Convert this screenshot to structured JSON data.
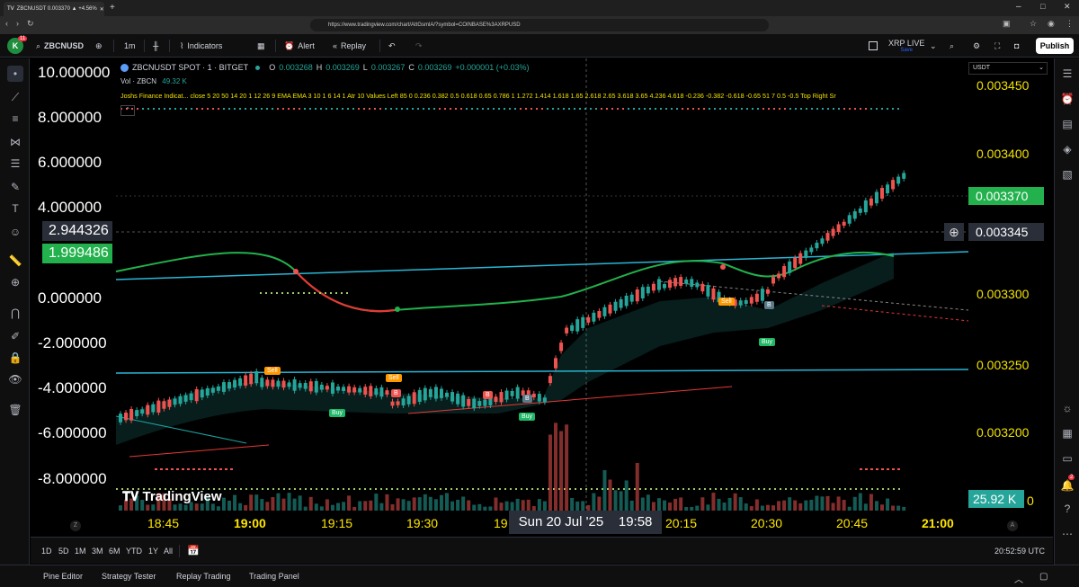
{
  "browser": {
    "tab_title": "ZBCNUSDT 0.003370 ▲ +4.56%",
    "url": "https://www.tradingview.com/chart/AttGsmlA/?symbol=COINBASE%3AXRPUSD"
  },
  "toolbar": {
    "avatar_letter": "K",
    "avatar_badge": "11",
    "symbol": "ZBCNUSD",
    "interval": "1m",
    "indicators_label": "Indicators",
    "alert_label": "Alert",
    "replay_label": "Replay",
    "layout_name": "XRP LIVE",
    "layout_sub": "Save",
    "publish_label": "Publish"
  },
  "legend": {
    "title": "ZBCNUSDT SPOT · 1 · BITGET",
    "o_label": "O",
    "o_value": "0.003268",
    "h_label": "H",
    "h_value": "0.003269",
    "l_label": "L",
    "l_value": "0.003267",
    "c_label": "C",
    "c_value": "0.003269",
    "change": "+0.000001 (+0.03%)",
    "vol_label": "Vol · ZBCN",
    "vol_value": "49.32 K",
    "indicator_text": "Joshs Finance Indicat...  close 5 20 50 14 20 1 12 26 9 EMA EMA 3 10 1 6 14 1 Atr 10 Values Left 85 0 0.236 0.382 0.5 0.618 0.65 0.786 1 1.272 1.414 1.618 1.65 2.618 2.65 3.618 3.65 4.236 4.618 -0.236 -0.382 -0.618 -0.65 51 7 0.5 -0.5 Top Right Sr"
  },
  "left_axis": {
    "ticks": [
      "10.000000",
      "8.000000",
      "6.000000",
      "4.000000",
      "0.000000",
      "-2.000000",
      "-4.000000",
      "-6.000000",
      "-8.000000"
    ],
    "tag_gray": "2.944326",
    "tag_green": "1.999486"
  },
  "right_axis": {
    "currency": "USDT",
    "ticks": [
      "0.003450",
      "0.003400",
      "0.003300",
      "0.003250",
      "0.003200"
    ],
    "last_price": "0.003370",
    "crosshair_price": "0.003345",
    "volume_tag": "25.92 K",
    "edge_label": "0"
  },
  "time_axis": {
    "ticks": [
      "18:45",
      "19:00",
      "19:15",
      "19:30",
      "19",
      "20:15",
      "20:30",
      "20:45",
      "21:00"
    ],
    "crosshair_label": "Sun 20 Jul '25    19:58"
  },
  "signals": {
    "sell": "Sell",
    "buy": "Buy",
    "b": "B"
  },
  "watermark": "TradingView",
  "ranges": [
    "1D",
    "5D",
    "1M",
    "3M",
    "6M",
    "YTD",
    "1Y",
    "All"
  ],
  "clock": "20:52:59 UTC",
  "panels": [
    "Pine Editor",
    "Strategy Tester",
    "Replay Trading",
    "Trading Panel"
  ],
  "colors": {
    "up": "#26a69a",
    "down": "#ef5350",
    "green_tag": "#22b14c",
    "accent_yellow": "#ffe600",
    "cyan_line": "#29b6d6"
  }
}
